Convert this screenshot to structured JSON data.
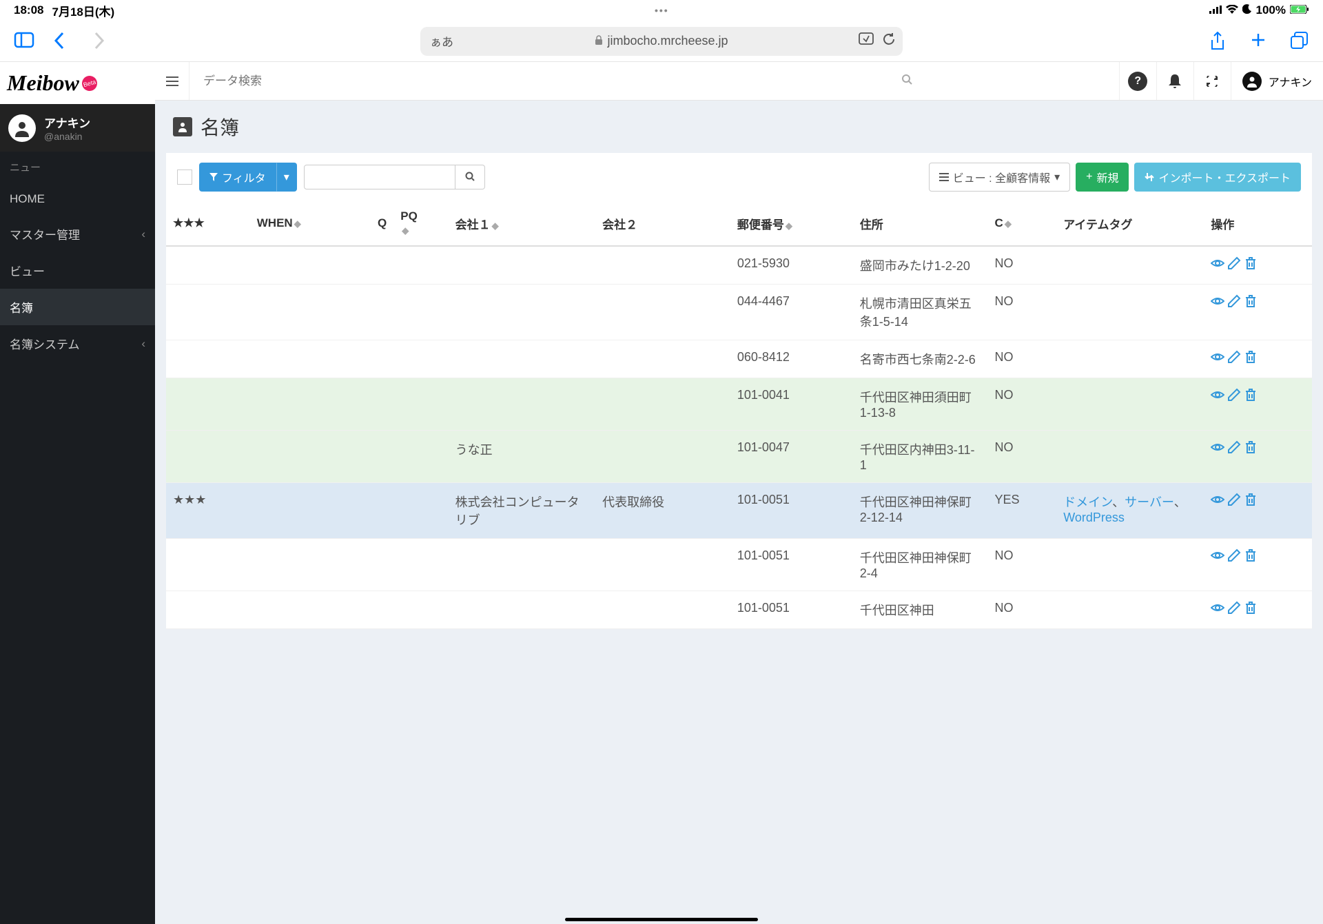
{
  "status_bar": {
    "time": "18:08",
    "date": "7月18日(木)",
    "battery": "100%"
  },
  "browser": {
    "aa_label": "ぁあ",
    "url": "jimbocho.mrcheese.jp"
  },
  "app": {
    "logo": "Meibow",
    "logo_badge": "Beta",
    "search_placeholder": "データ検索",
    "user_display": "アナキン"
  },
  "sidebar": {
    "user": {
      "name": "アナキン",
      "handle": "@anakin"
    },
    "section_label": "ニュー",
    "items": [
      {
        "label": "HOME",
        "has_children": false
      },
      {
        "label": "マスター管理",
        "has_children": true
      },
      {
        "label": "ビュー",
        "has_children": false
      },
      {
        "label": "名簿",
        "has_children": false,
        "active": true
      },
      {
        "label": "名簿システム",
        "has_children": true
      }
    ]
  },
  "page": {
    "title": "名簿"
  },
  "toolbar": {
    "filter_label": "フィルタ",
    "view_label": "ビュー : 全顧客情報",
    "new_label": "新規",
    "import_export_label": "インポート・エクスポート"
  },
  "table": {
    "columns": {
      "star": "★★★",
      "when": "WHEN",
      "q": "Q",
      "pq": "PQ",
      "company1": "会社１",
      "company2": "会社２",
      "postal": "郵便番号",
      "address": "住所",
      "c": "C",
      "tags": "アイテムタグ",
      "actions": "操作"
    },
    "rows": [
      {
        "star": "",
        "company1": "",
        "company2": "",
        "postal": "021-5930",
        "address": "盛岡市みたけ1-2-20",
        "c": "NO",
        "tags": "",
        "cls": ""
      },
      {
        "star": "",
        "company1": "",
        "company2": "",
        "postal": "044-4467",
        "address": "札幌市清田区真栄五条1-5-14",
        "c": "NO",
        "tags": "",
        "cls": ""
      },
      {
        "star": "",
        "company1": "",
        "company2": "",
        "postal": "060-8412",
        "address": "名寄市西七条南2-2-6",
        "c": "NO",
        "tags": "",
        "cls": ""
      },
      {
        "star": "",
        "company1": "",
        "company2": "",
        "postal": "101-0041",
        "address": "千代田区神田須田町1-13-8",
        "c": "NO",
        "tags": "",
        "cls": "row-green"
      },
      {
        "star": "",
        "company1": "うな正",
        "company2": "",
        "postal": "101-0047",
        "address": "千代田区内神田3-11-1",
        "c": "NO",
        "tags": "",
        "cls": "row-green"
      },
      {
        "star": "★★★",
        "company1": "株式会社コンピュータリブ",
        "company2": "代表取締役",
        "postal": "101-0051",
        "address": "千代田区神田神保町2-12-14",
        "c": "YES",
        "tags": "ドメイン、サーバー、WordPress",
        "cls": "row-blue"
      },
      {
        "star": "",
        "company1": "",
        "company2": "",
        "postal": "101-0051",
        "address": "千代田区神田神保町2-4",
        "c": "NO",
        "tags": "",
        "cls": ""
      },
      {
        "star": "",
        "company1": "",
        "company2": "",
        "postal": "101-0051",
        "address": "千代田区神田",
        "c": "NO",
        "tags": "",
        "cls": ""
      }
    ]
  }
}
